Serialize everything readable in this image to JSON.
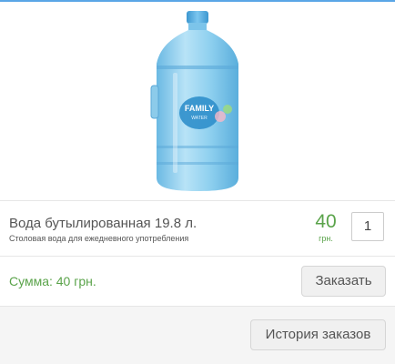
{
  "product": {
    "image_label": "FAMILY",
    "image_sublabel": "WATER",
    "name": "Вода бутылированная 19.8 л.",
    "description": "Столовая вода для ежедневного употребления",
    "price": "40",
    "price_unit": "грн.",
    "quantity": "1"
  },
  "summary": {
    "sum_text": "Сумма: 40 грн.",
    "order_button": "Заказать"
  },
  "footer": {
    "history_button": "История заказов"
  },
  "colors": {
    "accent_line": "#5aa6e6",
    "price_green": "#5aa34a",
    "bottle_blue": "#7fc6ea"
  }
}
